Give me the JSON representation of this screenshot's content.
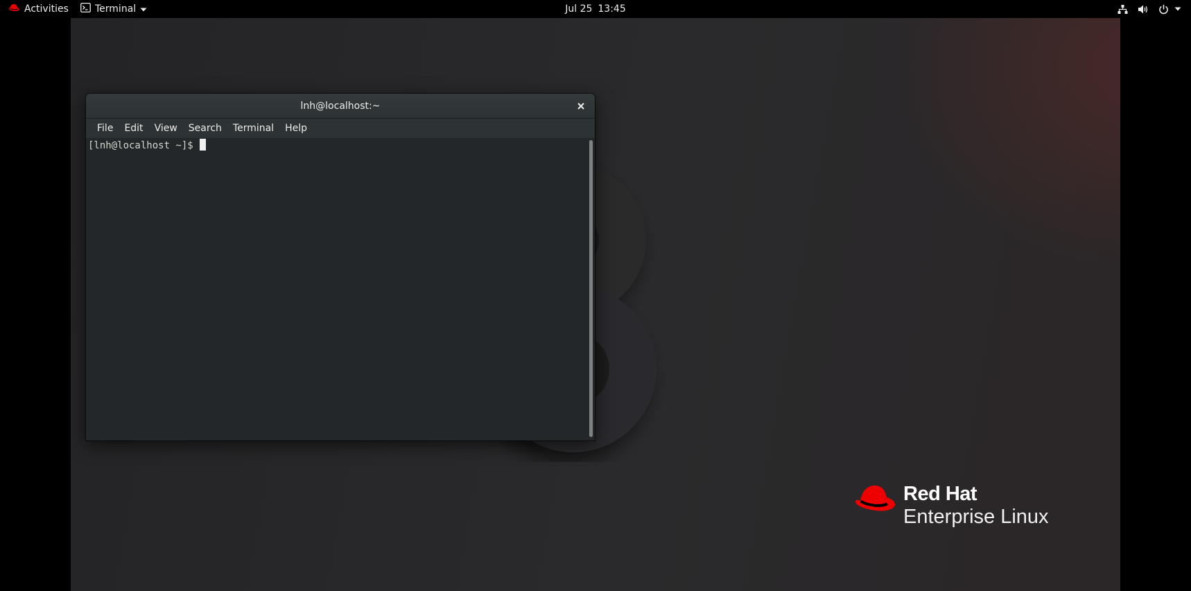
{
  "topbar": {
    "activities_label": "Activities",
    "app_menu_label": "Terminal",
    "clock_date": "Jul 25",
    "clock_time": "13:45",
    "icons": [
      "redhat-icon",
      "terminal-app-icon",
      "chevron-down-icon",
      "network-icon",
      "volume-icon",
      "power-icon"
    ]
  },
  "terminal_window": {
    "title": "lnh@localhost:~",
    "menu": {
      "file": "File",
      "edit": "Edit",
      "view": "View",
      "search": "Search",
      "terminal": "Terminal",
      "help": "Help"
    },
    "prompt": "[lnh@localhost ~]$ ",
    "icons": [
      "close-icon"
    ]
  },
  "wallpaper": {
    "brand": "Red Hat",
    "product": "Enterprise Linux",
    "brand_color": "#ee0000"
  },
  "colors": {
    "topbar": "#000000",
    "terminal_bg": "#232729",
    "terminal_fg": "#d3d7cf",
    "titlebar": "#2d3234"
  }
}
